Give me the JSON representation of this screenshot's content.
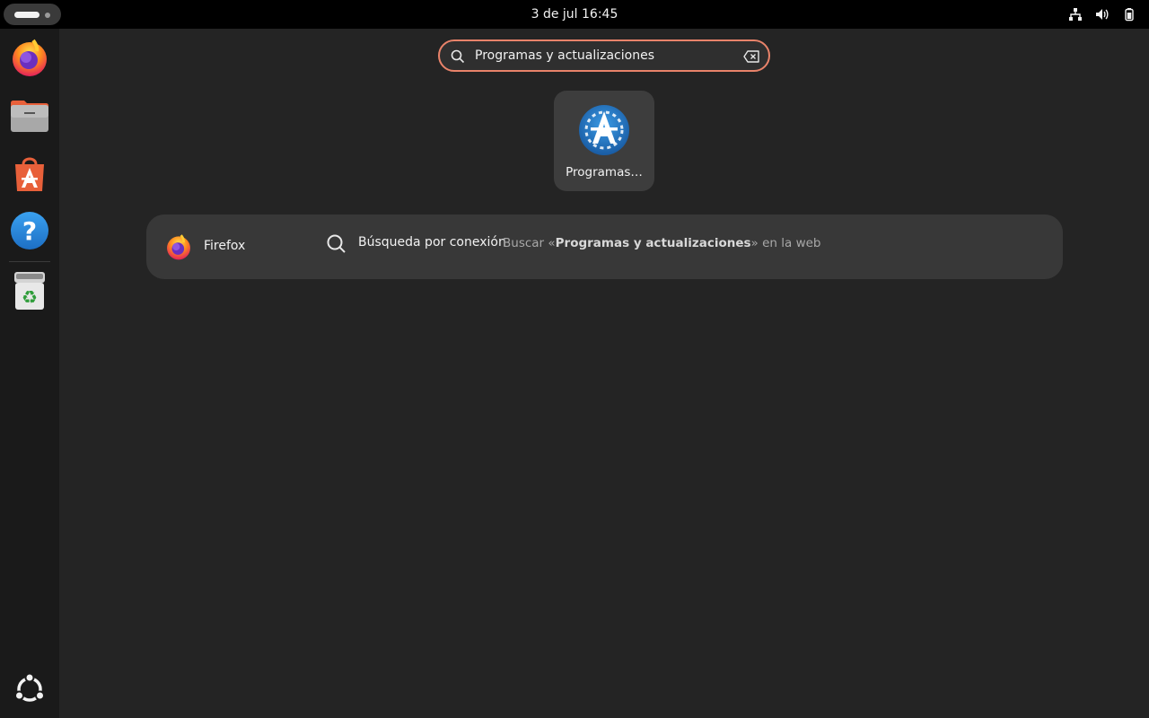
{
  "topbar": {
    "clock": "3 de jul  16:45",
    "tray_icons": [
      "network-icon",
      "volume-icon",
      "battery-icon"
    ]
  },
  "dock": {
    "items": [
      {
        "name": "Firefox",
        "icon": "firefox-icon"
      },
      {
        "name": "Files",
        "icon": "files-icon"
      },
      {
        "name": "App Center",
        "icon": "app-center-icon"
      },
      {
        "name": "Help",
        "icon": "help-icon"
      },
      {
        "name": "Trash",
        "icon": "trash-icon"
      }
    ],
    "show_apps_icon": "ubuntu-logo-icon"
  },
  "search": {
    "value": "Programas y actualizaciones",
    "search_icon": "search-icon",
    "clear_icon": "clear-icon"
  },
  "app_results": [
    {
      "label": "Programas…",
      "icon": "software-updates-icon"
    }
  ],
  "provider_results": {
    "app": "Firefox",
    "item_title": "Búsqueda por conexión",
    "item_desc_prefix": "Buscar «",
    "item_desc_query": "Programas y actualizaciones",
    "item_desc_suffix": "» en la web"
  },
  "colors": {
    "accent": "#e9836a",
    "background": "#242424",
    "dock": "#1a1a1a"
  }
}
